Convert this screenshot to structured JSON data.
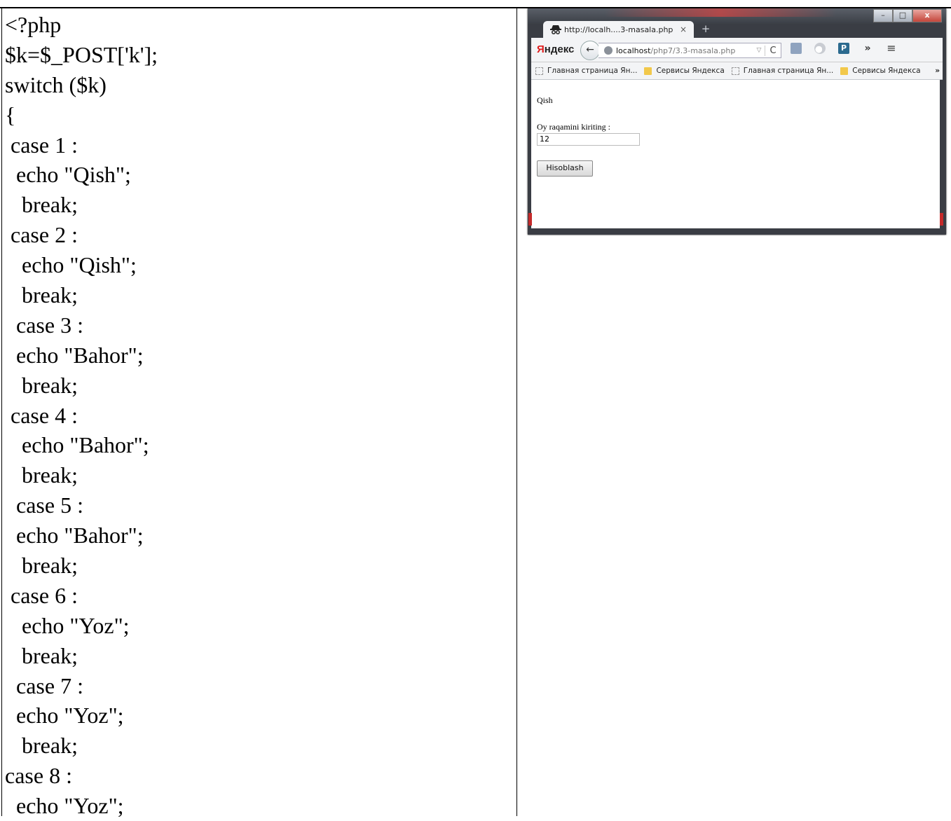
{
  "code_lines": [
    "<?php",
    "$k=$_POST['k'];",
    "switch ($k)",
    "{",
    " case 1 :",
    "  echo \"Qish\";",
    "   break;",
    " case 2 :",
    "   echo \"Qish\";",
    "   break;",
    "  case 3 :",
    "  echo \"Bahor\";",
    "   break;",
    " case 4 :",
    "   echo \"Bahor\";",
    "   break;",
    "  case 5 :",
    "  echo \"Bahor\";",
    "   break;",
    " case 6 :",
    "   echo \"Yoz\";",
    "   break;",
    "  case 7 :",
    "  echo \"Yoz\";",
    "   break;",
    "case 8 :",
    "  echo \"Yoz\";"
  ],
  "browser": {
    "window_buttons": {
      "minimize": "–",
      "maximize": "□",
      "close": "x"
    },
    "tab": {
      "title": "http://localh....3-masala.php",
      "close": "×"
    },
    "new_tab": "+",
    "brand": {
      "first_letter": "Я",
      "rest": "ндекс"
    },
    "back": "←",
    "url": {
      "host": "localhost",
      "path": "/php7/3.3-masala.php",
      "dropdown": "▽",
      "reload": "C"
    },
    "toolbar_more": "»",
    "toolbar_menu": "≡",
    "pbtn_label": "P",
    "bookmarks": [
      {
        "label": "Главная страница Ян...",
        "icon": "page"
      },
      {
        "label": "Сервисы Яндекса",
        "icon": "folder"
      },
      {
        "label": "Главная страница Ян...",
        "icon": "page"
      },
      {
        "label": "Сервисы Яндекса",
        "icon": "folder"
      }
    ],
    "bookmarks_more": "»",
    "page": {
      "result": "Qish",
      "label": "Oy raqamini kiriting :",
      "input_value": "12",
      "button": "Hisoblash"
    }
  }
}
